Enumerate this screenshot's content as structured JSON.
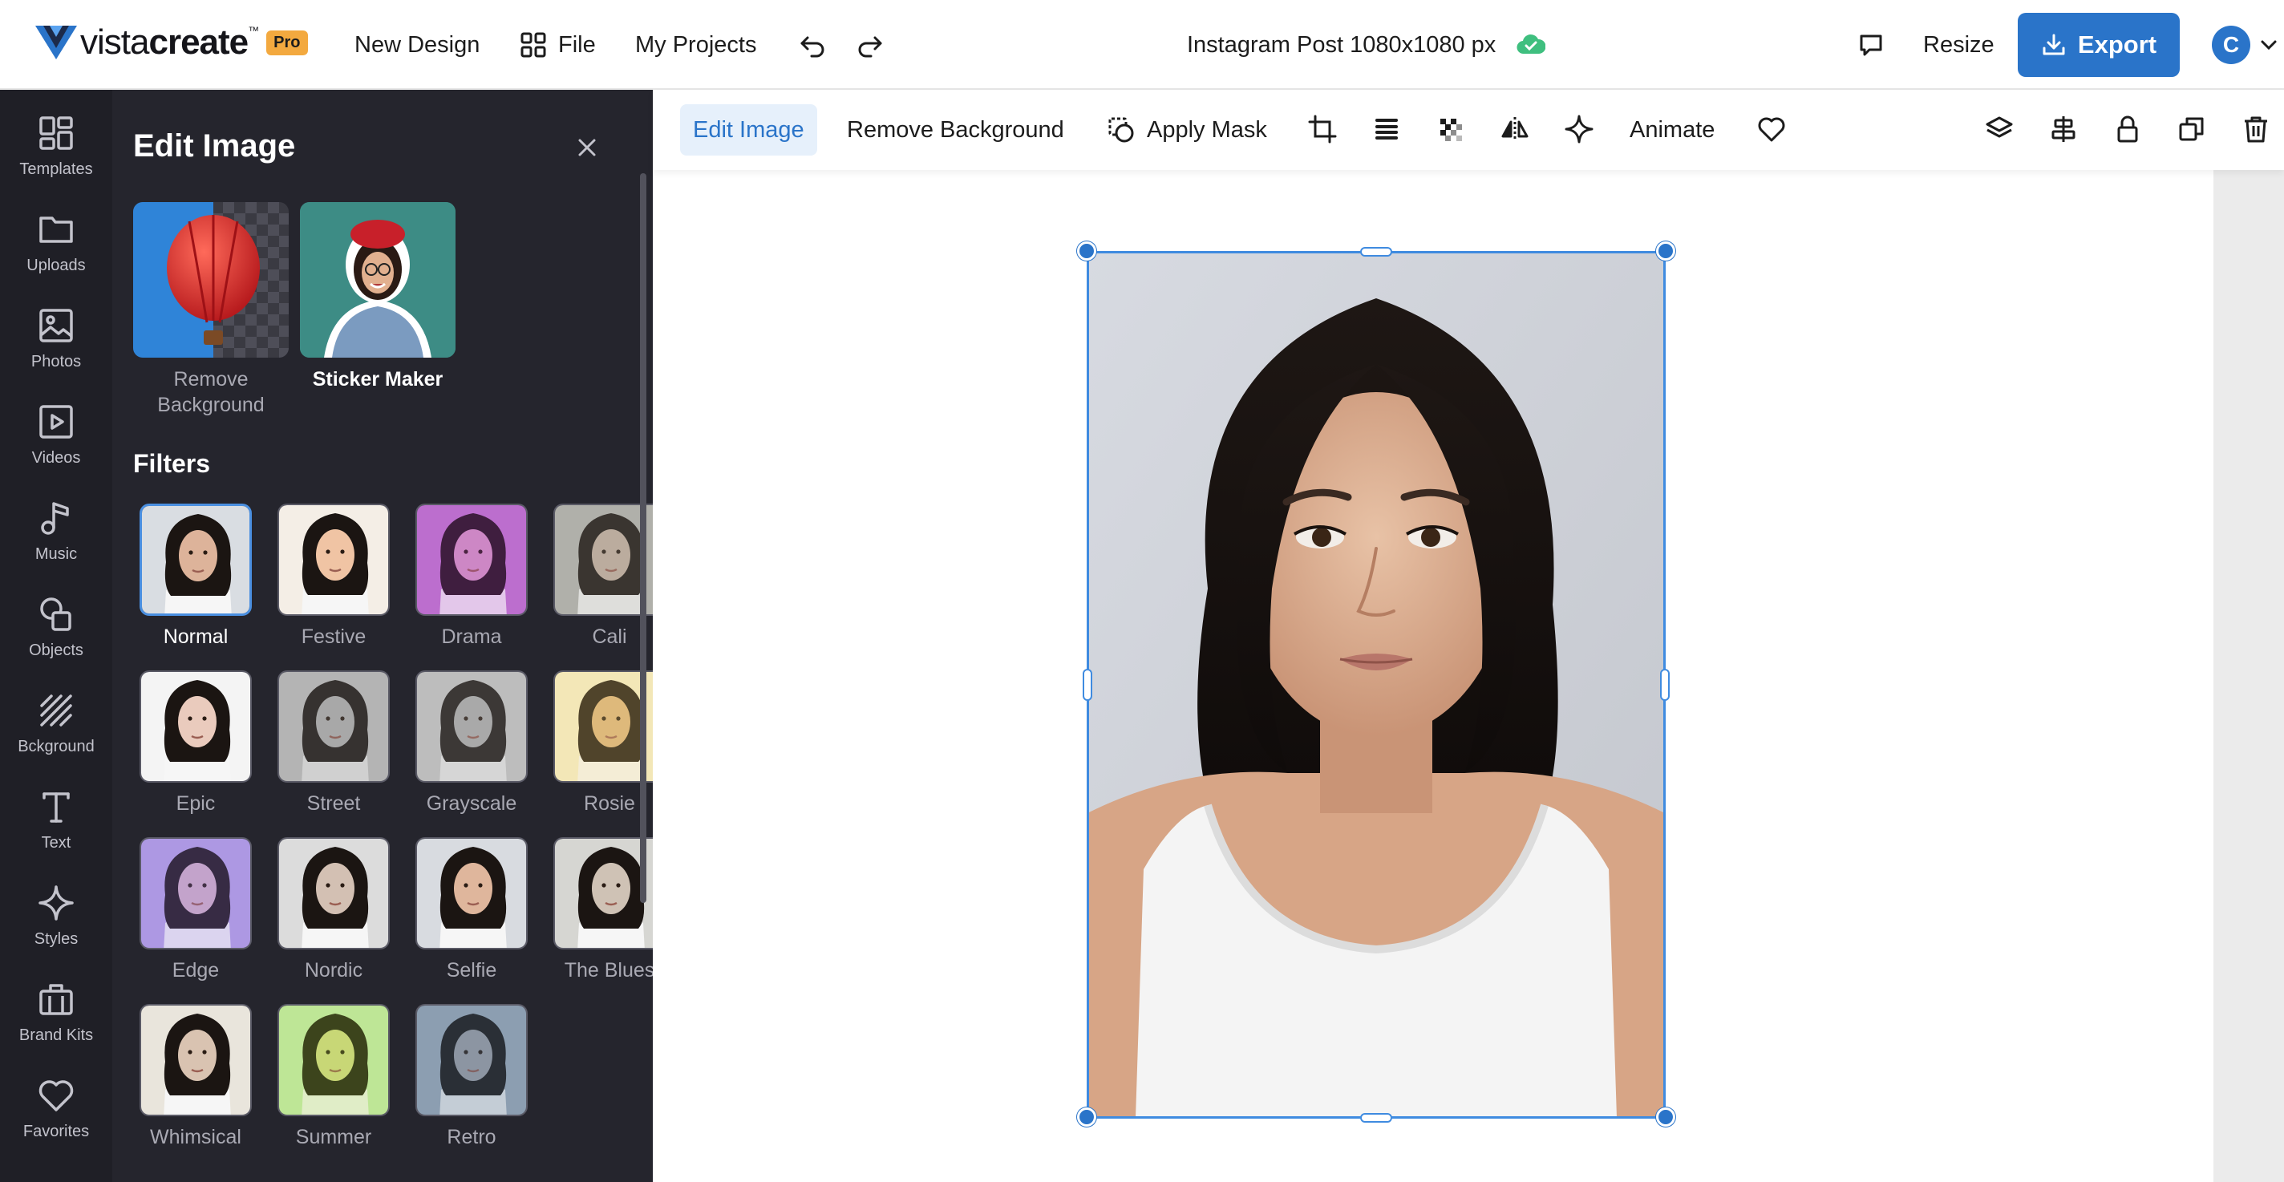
{
  "header": {
    "logo_text_regular": "vista",
    "logo_text_bold": "create",
    "pro_badge": "Pro",
    "new_design": "New Design",
    "file": "File",
    "my_projects": "My Projects",
    "document_title": "Instagram Post 1080x1080 px",
    "resize": "Resize",
    "export": "Export",
    "avatar_initial": "C"
  },
  "rail": {
    "items": [
      {
        "label": "Templates",
        "icon": "templates-icon"
      },
      {
        "label": "Uploads",
        "icon": "folder-icon"
      },
      {
        "label": "Photos",
        "icon": "photo-icon"
      },
      {
        "label": "Videos",
        "icon": "video-icon"
      },
      {
        "label": "Music",
        "icon": "music-note-icon"
      },
      {
        "label": "Objects",
        "icon": "shapes-icon"
      },
      {
        "label": "Bckground",
        "icon": "background-stripes-icon"
      },
      {
        "label": "Text",
        "icon": "text-t-icon"
      },
      {
        "label": "Styles",
        "icon": "sparkle-icon"
      },
      {
        "label": "Brand Kits",
        "icon": "briefcase-icon"
      },
      {
        "label": "Favorites",
        "icon": "heart-icon"
      }
    ]
  },
  "panel": {
    "title": "Edit Image",
    "tools": [
      {
        "label": "Remove Background"
      },
      {
        "label": "Sticker Maker"
      }
    ],
    "filters_title": "Filters",
    "filters": [
      {
        "label": "Normal",
        "selected": true
      },
      {
        "label": "Festive"
      },
      {
        "label": "Drama"
      },
      {
        "label": "Cali"
      },
      {
        "label": "Epic"
      },
      {
        "label": "Street"
      },
      {
        "label": "Grayscale"
      },
      {
        "label": "Rosie"
      },
      {
        "label": "Edge"
      },
      {
        "label": "Nordic"
      },
      {
        "label": "Selfie"
      },
      {
        "label": "The Blues"
      },
      {
        "label": "Whimsical"
      },
      {
        "label": "Summer"
      },
      {
        "label": "Retro"
      }
    ]
  },
  "toolbar": {
    "edit_image": "Edit Image",
    "remove_background": "Remove Background",
    "apply_mask": "Apply Mask",
    "animate": "Animate"
  },
  "colors": {
    "accent": "#2a74c9",
    "pro_badge": "#f3a93f",
    "panel_bg": "#25252d",
    "rail_bg": "#1f1f26",
    "cloud_ok": "#3fbf7f"
  }
}
